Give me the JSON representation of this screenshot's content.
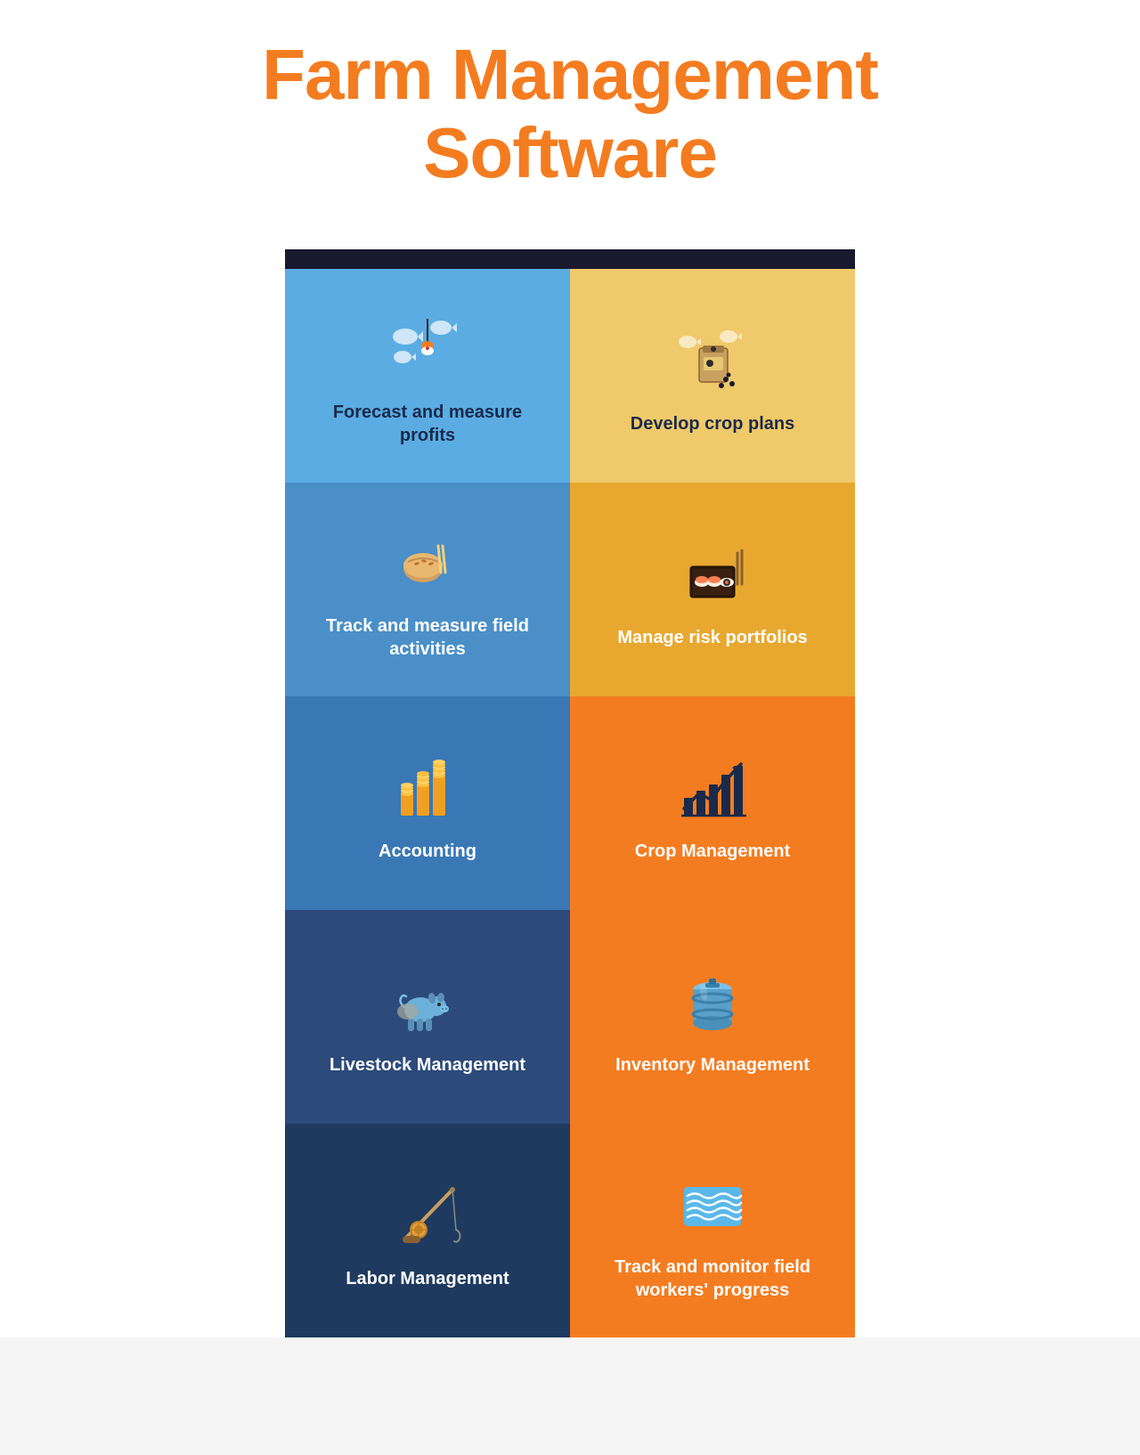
{
  "header": {
    "title_line1": "Farm Management",
    "title_line2": "Software"
  },
  "cells": [
    {
      "id": "forecast",
      "label": "Forecast and measure profits",
      "bg": "blue-light",
      "label_color": "dark",
      "icon": "fishing"
    },
    {
      "id": "crop-plans",
      "label": "Develop crop plans",
      "bg": "yellow-light",
      "label_color": "dark",
      "icon": "bag"
    },
    {
      "id": "track-field",
      "label": "Track and measure field activities",
      "bg": "blue-mid",
      "label_color": "white",
      "icon": "food"
    },
    {
      "id": "risk",
      "label": "Manage risk portfolios",
      "bg": "yellow-dark",
      "label_color": "white",
      "icon": "sushi"
    },
    {
      "id": "accounting",
      "label": "Accounting",
      "bg": "blue-dark",
      "label_color": "white",
      "icon": "coins"
    },
    {
      "id": "crop-management",
      "label": "Crop Management",
      "bg": "orange",
      "label_color": "white",
      "icon": "chart"
    },
    {
      "id": "livestock",
      "label": "Livestock Management",
      "bg": "navy",
      "label_color": "white",
      "icon": "livestock"
    },
    {
      "id": "inventory",
      "label": "Inventory Management",
      "bg": "orange",
      "label_color": "white",
      "icon": "barrel"
    },
    {
      "id": "labor",
      "label": "Labor Management",
      "bg": "navy-dark",
      "label_color": "white",
      "icon": "fishing-rod"
    },
    {
      "id": "track-workers",
      "label": "Track and monitor field workers' progress",
      "bg": "orange",
      "label_color": "white",
      "icon": "water"
    }
  ]
}
